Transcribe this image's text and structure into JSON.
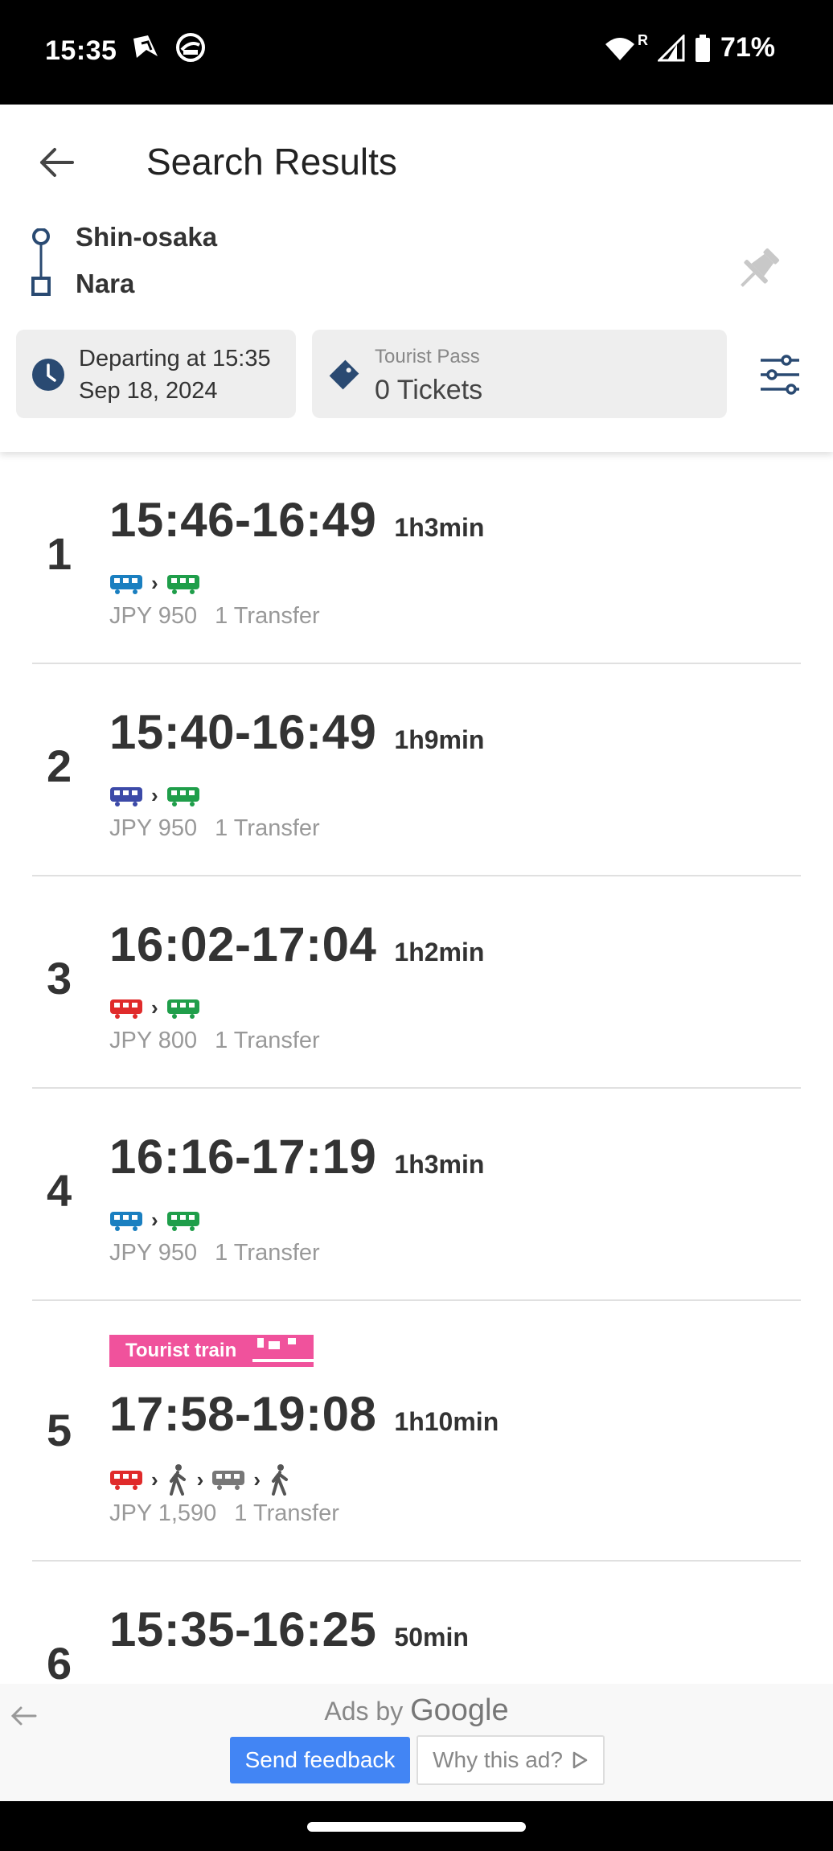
{
  "status_bar": {
    "time": "15:35",
    "battery": "71%",
    "network_flag": "R"
  },
  "header": {
    "title": "Search Results",
    "from_station": "Shin-osaka",
    "to_station": "Nara",
    "departure_line1": "Departing at 15:35",
    "departure_line2": "Sep 18, 2024",
    "pass_label": "Tourist Pass",
    "pass_value": "0 Tickets"
  },
  "colors": {
    "accent_navy": "#2a4a72",
    "train_blue": "#1a7fc0",
    "train_indigo": "#3c4aa8",
    "train_green": "#1f9e4a",
    "train_red": "#e02b2b",
    "train_gray": "#777777",
    "tourist_pink": "#f0529c"
  },
  "results": [
    {
      "index": "1",
      "time": "15:46-16:49",
      "duration": "1h3min",
      "price": "JPY 950",
      "transfers": "1 Transfer",
      "legs": [
        "train-blue",
        "train-green"
      ]
    },
    {
      "index": "2",
      "time": "15:40-16:49",
      "duration": "1h9min",
      "price": "JPY 950",
      "transfers": "1 Transfer",
      "legs": [
        "train-indigo",
        "train-green"
      ]
    },
    {
      "index": "3",
      "time": "16:02-17:04",
      "duration": "1h2min",
      "price": "JPY 800",
      "transfers": "1 Transfer",
      "legs": [
        "train-red",
        "train-green"
      ]
    },
    {
      "index": "4",
      "time": "16:16-17:19",
      "duration": "1h3min",
      "price": "JPY 950",
      "transfers": "1 Transfer",
      "legs": [
        "train-blue",
        "train-green"
      ]
    },
    {
      "index": "5",
      "tag": "Tourist train",
      "time": "17:58-19:08",
      "duration": "1h10min",
      "price": "JPY 1,590",
      "transfers": "1 Transfer",
      "legs": [
        "train-red",
        "walk",
        "train-gray",
        "walk"
      ]
    },
    {
      "index": "6",
      "time": "15:35-16:25",
      "duration": "50min"
    }
  ],
  "ad": {
    "ads_by": "Ads by",
    "google": "Google",
    "send_feedback": "Send feedback",
    "why_this_ad": "Why this ad?"
  }
}
